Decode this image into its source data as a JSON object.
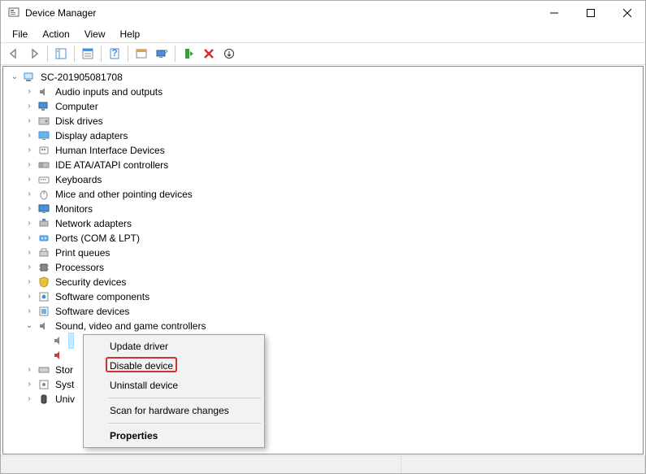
{
  "window": {
    "title": "Device Manager"
  },
  "menubar": {
    "file": "File",
    "action": "Action",
    "view": "View",
    "help": "Help"
  },
  "tree": {
    "root": "SC-201905081708",
    "categories": [
      "Audio inputs and outputs",
      "Computer",
      "Disk drives",
      "Display adapters",
      "Human Interface Devices",
      "IDE ATA/ATAPI controllers",
      "Keyboards",
      "Mice and other pointing devices",
      "Monitors",
      "Network adapters",
      "Ports (COM & LPT)",
      "Print queues",
      "Processors",
      "Security devices",
      "Software components",
      "Software devices",
      "Sound, video and game controllers"
    ],
    "remaining": [
      "Stor",
      "Syst",
      "Univ"
    ]
  },
  "context_menu": {
    "update": "Update driver",
    "disable": "Disable device",
    "uninstall": "Uninstall device",
    "scan": "Scan for hardware changes",
    "properties": "Properties"
  }
}
